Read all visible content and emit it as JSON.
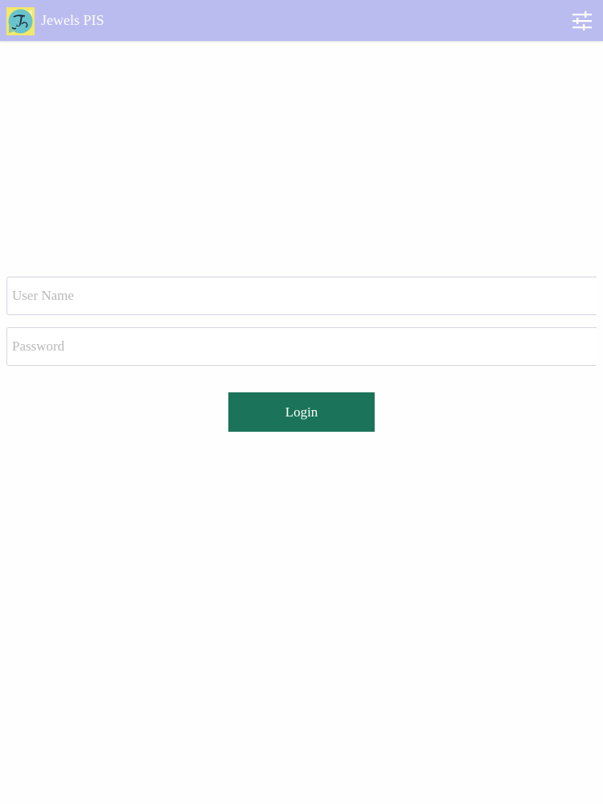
{
  "app_bar": {
    "title": "Jewels PIS",
    "logo_icon": "jewels-pis-logo",
    "logo_text": "J",
    "settings_icon": "sliders-settings-icon",
    "background_color": "#babcf0",
    "title_color": "#ffffff"
  },
  "login_form": {
    "username_placeholder": "User Name",
    "username_value": "",
    "password_placeholder": "Password",
    "password_value": "",
    "login_label": "Login",
    "login_color": "#1b7459"
  }
}
